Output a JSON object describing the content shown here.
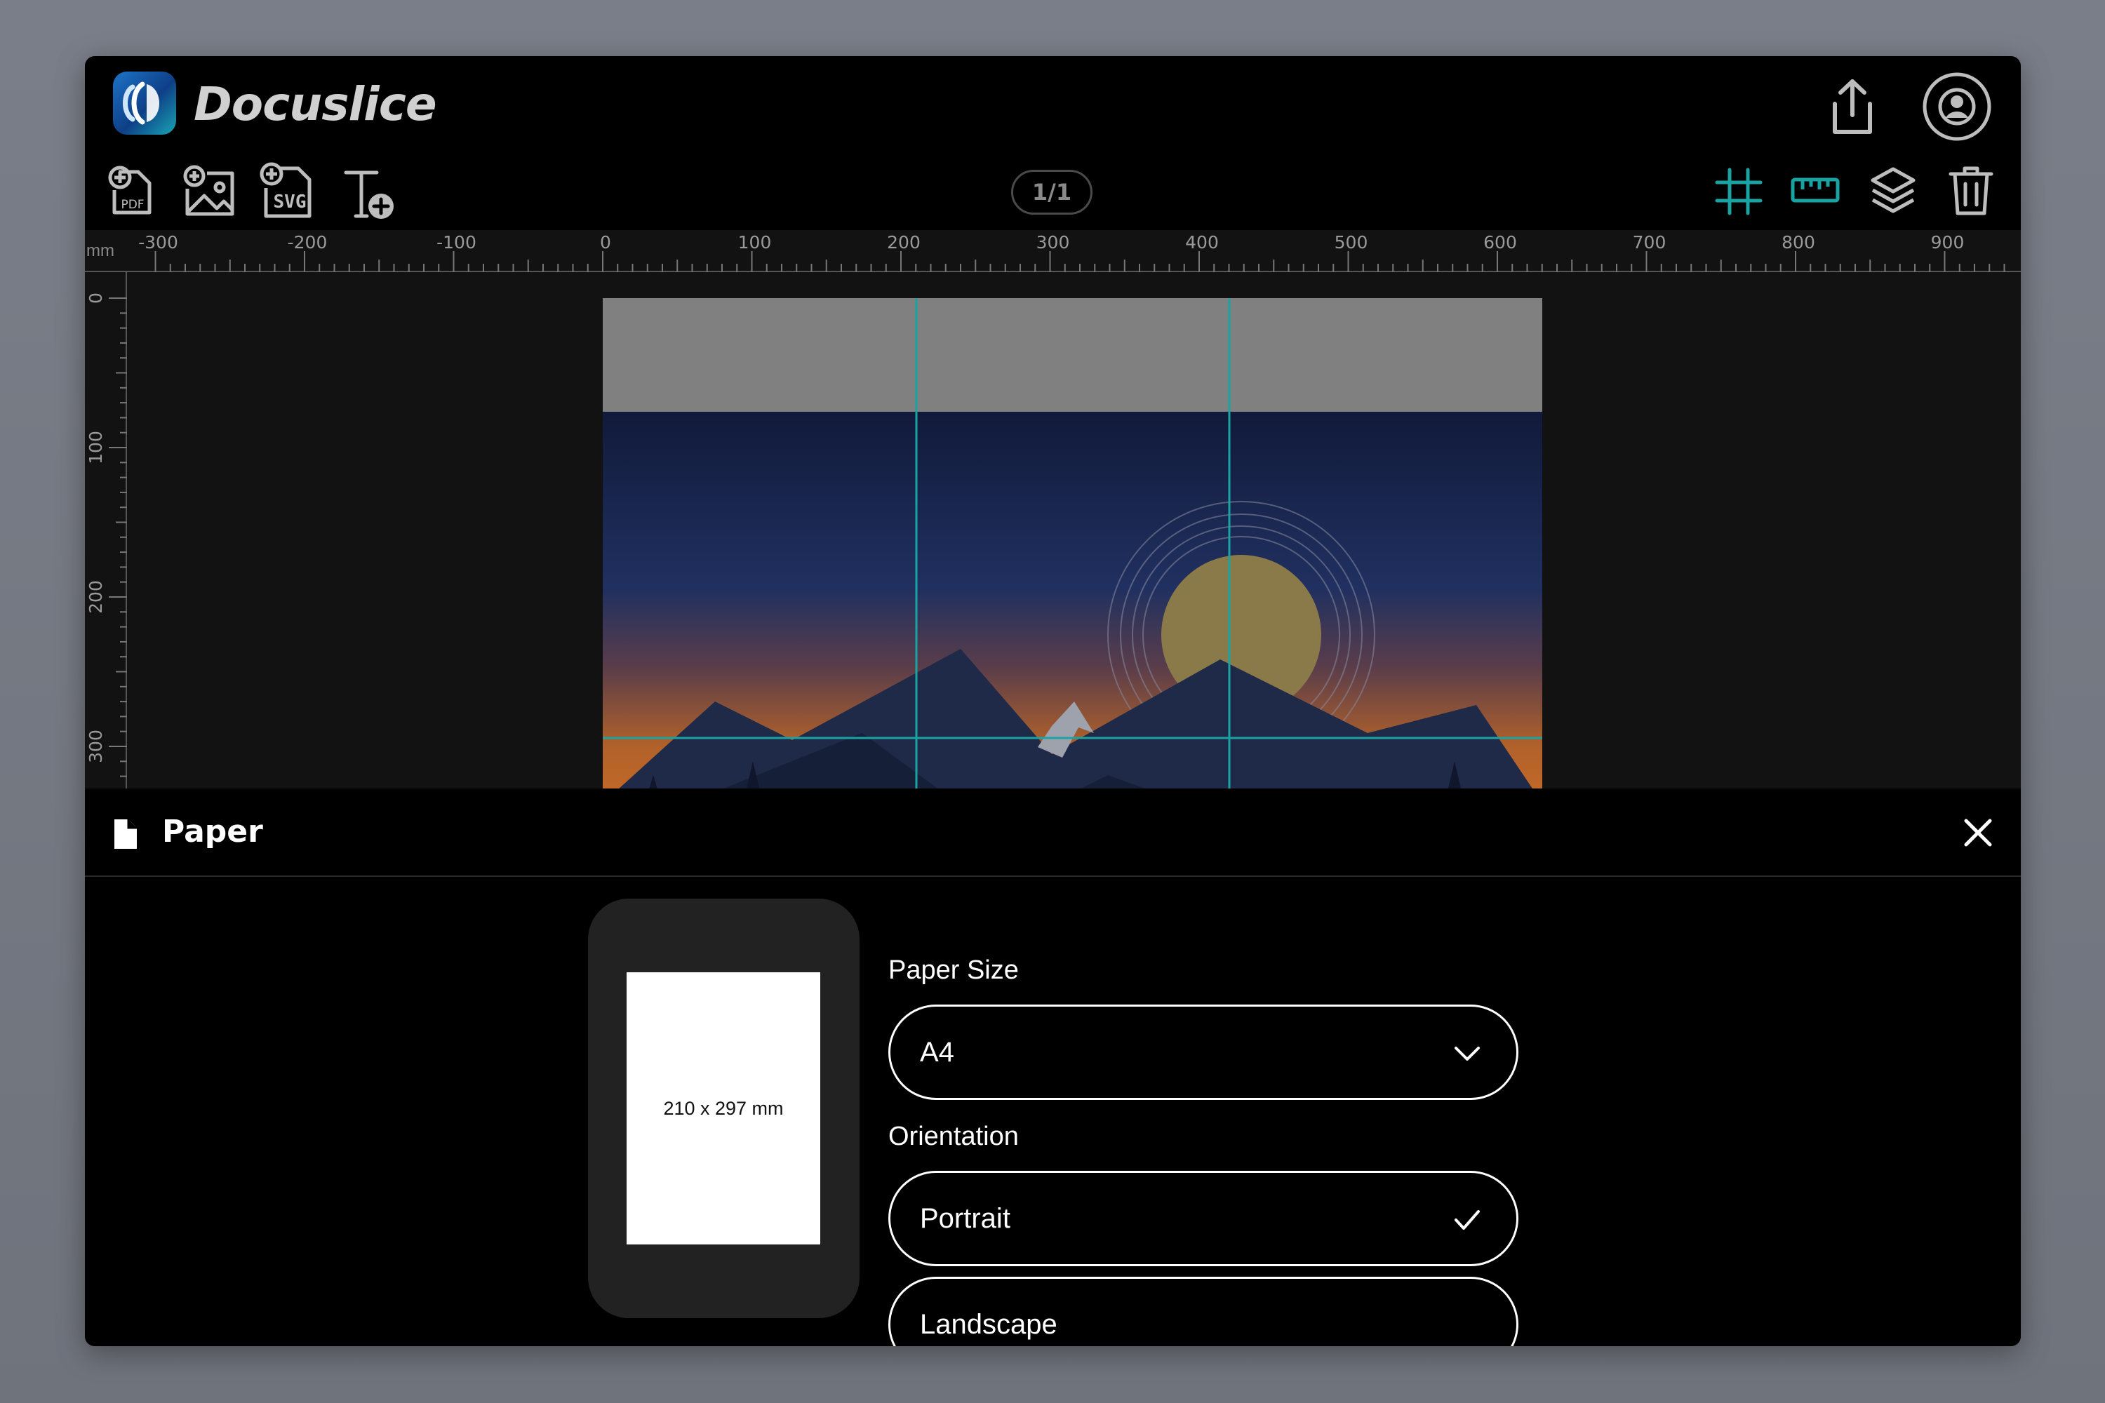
{
  "app": {
    "name": "Docuslice"
  },
  "toolbar": {
    "add_items": [
      {
        "name": "add-pdf-icon",
        "label": "PDF"
      },
      {
        "name": "add-image-icon"
      },
      {
        "name": "add-svg-icon",
        "label": "SVG"
      },
      {
        "name": "add-text-icon"
      }
    ],
    "page_indicator": "1/1",
    "right_tools": [
      "grid-icon",
      "ruler-icon",
      "layers-icon",
      "trash-icon"
    ],
    "accent_color": "#1aa3a3"
  },
  "header_actions": [
    "share-icon",
    "account-icon"
  ],
  "rulers": {
    "unit": "mm",
    "top_labels": [
      "-300",
      "-200",
      "-100",
      "0",
      "100",
      "200",
      "300",
      "400",
      "500",
      "600",
      "700",
      "800",
      "900"
    ],
    "left_labels": [
      "0",
      "100",
      "200",
      "300"
    ]
  },
  "panel": {
    "title": "Paper",
    "preview_text": "210 x 297 mm",
    "paper_size_label": "Paper Size",
    "paper_size_value": "A4",
    "orientation_label": "Orientation",
    "orientation_options": [
      {
        "label": "Portrait",
        "selected": true
      },
      {
        "label": "Landscape",
        "selected": false
      }
    ]
  }
}
